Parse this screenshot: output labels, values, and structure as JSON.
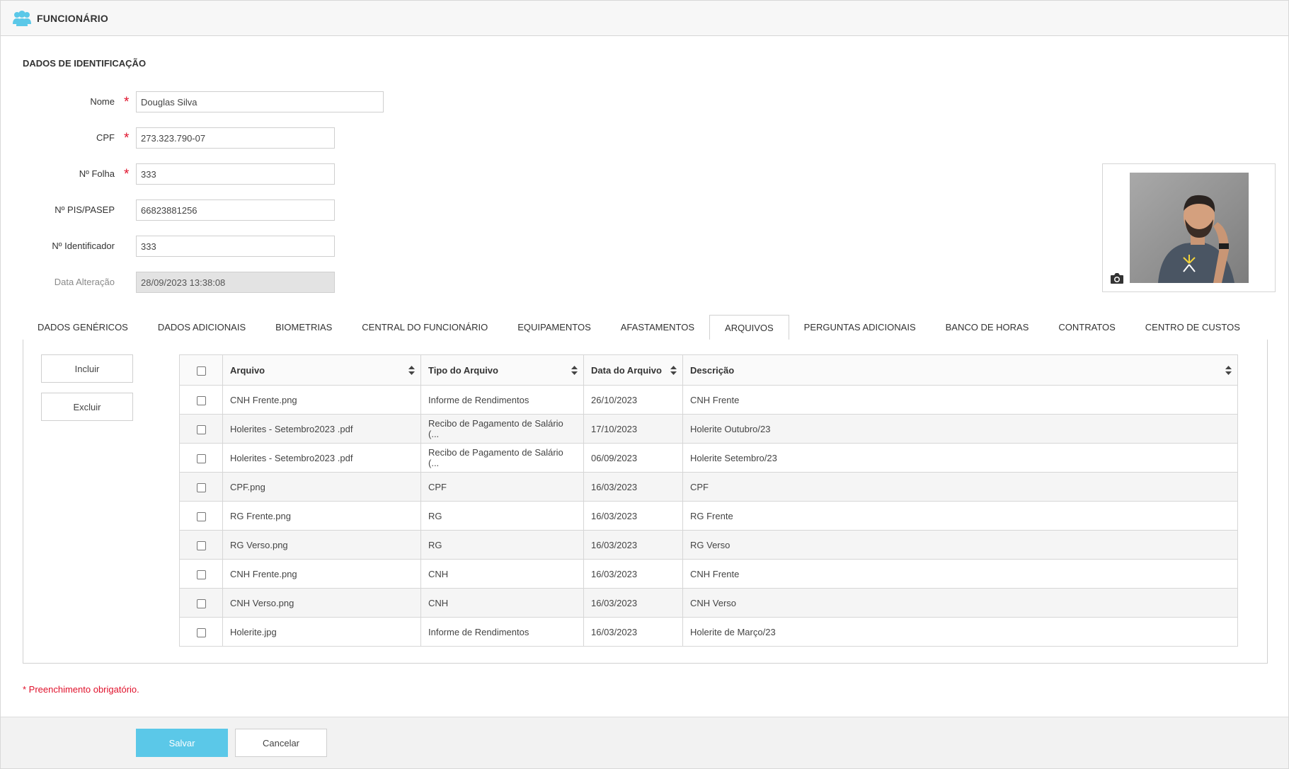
{
  "header": {
    "title": "FUNCIONÁRIO",
    "icon": "users-icon"
  },
  "section_title": "DADOS DE IDENTIFICAÇÃO",
  "form": {
    "nome": {
      "label": "Nome",
      "value": "Douglas Silva",
      "required": true
    },
    "cpf": {
      "label": "CPF",
      "value": "273.323.790-07",
      "required": true
    },
    "folha": {
      "label": "Nº Folha",
      "value": "333",
      "required": true
    },
    "pis": {
      "label": "Nº PIS/PASEP",
      "value": "66823881256",
      "required": false
    },
    "identificador": {
      "label": "Nº Identificador",
      "value": "333",
      "required": false
    },
    "data_alteracao": {
      "label": "Data Alteração",
      "value": "28/09/2023 13:38:08",
      "required": false
    },
    "required_marker": "*"
  },
  "photo": {
    "camera_icon": "camera-icon"
  },
  "tabs": [
    {
      "label": "DADOS GENÉRICOS",
      "active": false
    },
    {
      "label": "DADOS ADICIONAIS",
      "active": false
    },
    {
      "label": "BIOMETRIAS",
      "active": false
    },
    {
      "label": "CENTRAL DO FUNCIONÁRIO",
      "active": false
    },
    {
      "label": "EQUIPAMENTOS",
      "active": false
    },
    {
      "label": "AFASTAMENTOS",
      "active": false
    },
    {
      "label": "ARQUIVOS",
      "active": true
    },
    {
      "label": "PERGUNTAS ADICIONAIS",
      "active": false
    },
    {
      "label": "BANCO DE HORAS",
      "active": false
    },
    {
      "label": "CONTRATOS",
      "active": false
    },
    {
      "label": "CENTRO DE CUSTOS",
      "active": false
    }
  ],
  "actions": {
    "incluir": "Incluir",
    "excluir": "Excluir"
  },
  "table": {
    "columns": [
      "Arquivo",
      "Tipo do Arquivo",
      "Data do Arquivo",
      "Descrição"
    ],
    "rows": [
      {
        "arquivo": "CNH Frente.png",
        "tipo": "Informe de Rendimentos",
        "data": "26/10/2023",
        "descricao": "CNH Frente"
      },
      {
        "arquivo": "Holerites - Setembro2023 .pdf",
        "tipo": "Recibo de Pagamento de Salário (...",
        "data": "17/10/2023",
        "descricao": "Holerite Outubro/23"
      },
      {
        "arquivo": "Holerites - Setembro2023 .pdf",
        "tipo": "Recibo de Pagamento de Salário (...",
        "data": "06/09/2023",
        "descricao": "Holerite Setembro/23"
      },
      {
        "arquivo": "CPF.png",
        "tipo": "CPF",
        "data": "16/03/2023",
        "descricao": "CPF"
      },
      {
        "arquivo": "RG Frente.png",
        "tipo": "RG",
        "data": "16/03/2023",
        "descricao": "RG Frente"
      },
      {
        "arquivo": "RG Verso.png",
        "tipo": "RG",
        "data": "16/03/2023",
        "descricao": "RG Verso"
      },
      {
        "arquivo": "CNH Frente.png",
        "tipo": "CNH",
        "data": "16/03/2023",
        "descricao": "CNH Frente"
      },
      {
        "arquivo": "CNH Verso.png",
        "tipo": "CNH",
        "data": "16/03/2023",
        "descricao": "CNH Verso"
      },
      {
        "arquivo": "Holerite.jpg",
        "tipo": "Informe de Rendimentos",
        "data": "16/03/2023",
        "descricao": "Holerite de Março/23"
      }
    ]
  },
  "required_note": "* Preenchimento obrigatório.",
  "footer": {
    "save": "Salvar",
    "cancel": "Cancelar"
  },
  "colors": {
    "accent": "#5bc8e8",
    "required": "#e0112b",
    "header_icon": "#5bc8e8"
  }
}
